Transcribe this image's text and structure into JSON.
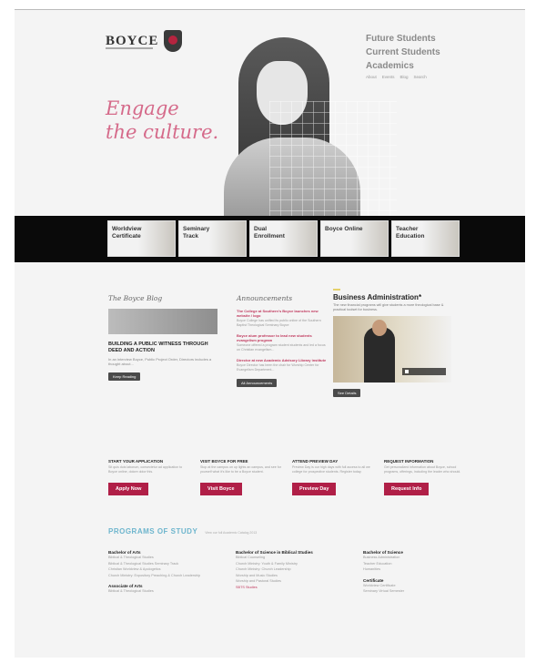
{
  "header": {
    "logo_text": "BOYCE",
    "nav_main": [
      "Future Students",
      "Current Students",
      "Academics"
    ],
    "nav_small": [
      "About",
      "Events",
      "Blog",
      "Search"
    ]
  },
  "hero": {
    "tagline_line1": "Engage",
    "tagline_line2": "the culture."
  },
  "band_tiles": [
    "Worldview Certificate",
    "Seminary Track",
    "Dual Enrollment",
    "Boyce Online",
    "Teacher Education"
  ],
  "blog": {
    "title": "The Boyce Blog",
    "headline": "BUILDING A PUBLIC WITNESS THROUGH DEED AND ACTION",
    "excerpt": "In an interview Boyce, Public Project Order, Directors includes a thought about...",
    "button": "Keep Reading"
  },
  "announcements": {
    "title": "Announcements",
    "items": [
      {
        "link": "The College at Southern's Boyce launches new website / logo",
        "text": "Boyce College has unified its public online of the Southern Baptist Theological Seminary Boyce"
      },
      {
        "link": "Boyce alum professor to lead new students evangelism program",
        "text": "Someone offered a program student students and led a focus on Christian evangelism..."
      },
      {
        "link": "Director at new Academic Advisory Library institute",
        "text": "Boyce Director has been the chair for Worship Center for Evangelism Department..."
      }
    ],
    "button": "All Announcements"
  },
  "feature": {
    "title": "Business Administration*",
    "text": "The new financial programs will give students a more theological base & practical toolset for business.",
    "button": "See Details"
  },
  "actions": [
    {
      "title": "START YOUR APPLICATION",
      "text": "Sit quis duis laborum, consectetur ad application to Boyce online, dolore dolor this.",
      "button": "Apply Now"
    },
    {
      "title": "VISIT BOYCE FOR FREE",
      "text": "Stop at the campus on up lights an campus, and see for yourself what it's like to be a Boyce student.",
      "button": "Visit Boyce"
    },
    {
      "title": "ATTEND PREVIEW DAY",
      "text": "Preview Day is our high days with full access to all we college for prospective students. Register today.",
      "button": "Preview Day"
    },
    {
      "title": "REQUEST INFORMATION",
      "text": "Get personalized information about Boyce, school programs, offerings, including the leader who should.",
      "button": "Request Info"
    }
  ],
  "programs": {
    "title": "PROGRAMS OF STUDY",
    "note": "View our full Academic Catalog 2013",
    "columns": [
      {
        "groups": [
          {
            "heading": "Bachelor of Arts",
            "items": [
              "Biblical & Theological Studies",
              "Biblical & Theological Studies Seminary Track",
              "Christian Worldview & Apologetics",
              "Church Ministry: Expository Preaching & Church Leadership"
            ]
          },
          {
            "heading": "Associate of Arts",
            "items": [
              "Biblical & Theological Studies"
            ]
          }
        ]
      },
      {
        "groups": [
          {
            "heading": "Bachelor of Science in Biblical Studies",
            "items": [
              "Biblical Counseling",
              "Church Ministry: Youth & Family Ministry",
              "Church Ministry: Church Leadership",
              "Worship and Music Studies",
              "Worship and Pastoral Studies",
              "SBTS Studies"
            ]
          }
        ]
      },
      {
        "groups": [
          {
            "heading": "Bachelor of Science",
            "items": [
              "Business Administration",
              "Teacher Education",
              "Humanities"
            ]
          },
          {
            "heading": "Certificate",
            "items": [
              "Worldview Certificate",
              "Seminary Virtual Semester"
            ]
          }
        ]
      }
    ]
  }
}
